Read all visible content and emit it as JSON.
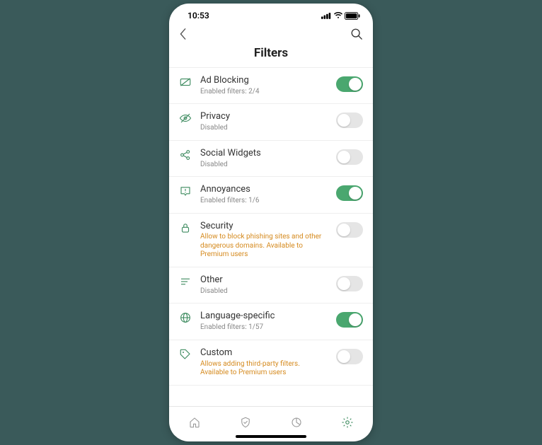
{
  "status": {
    "time": "10:53"
  },
  "header": {
    "title": "Filters"
  },
  "colors": {
    "accent": "#4aa76f",
    "iconGreen": "#3d8b5f",
    "premium": "#d58a1e"
  },
  "filters": [
    {
      "id": "ad-blocking",
      "label": "Ad Blocking",
      "sub": "Enabled filters: 2/4",
      "premium": false,
      "on": true,
      "icon": "ad-block-icon"
    },
    {
      "id": "privacy",
      "label": "Privacy",
      "sub": "Disabled",
      "premium": false,
      "on": false,
      "icon": "eye-off-icon"
    },
    {
      "id": "social",
      "label": "Social Widgets",
      "sub": "Disabled",
      "premium": false,
      "on": false,
      "icon": "share-icon"
    },
    {
      "id": "annoyances",
      "label": "Annoyances",
      "sub": "Enabled filters: 1/6",
      "premium": false,
      "on": true,
      "icon": "alert-box-icon"
    },
    {
      "id": "security",
      "label": "Security",
      "sub": "Allow to block phishing sites and other dangerous domains. Available to Premium users",
      "premium": true,
      "on": false,
      "icon": "lock-icon"
    },
    {
      "id": "other",
      "label": "Other",
      "sub": "Disabled",
      "premium": false,
      "on": false,
      "icon": "lines-icon"
    },
    {
      "id": "language",
      "label": "Language-specific",
      "sub": "Enabled filters: 1/57",
      "premium": false,
      "on": true,
      "icon": "globe-icon"
    },
    {
      "id": "custom",
      "label": "Custom",
      "sub": "Allows adding third-party filters. Available to Premium users",
      "premium": true,
      "on": false,
      "icon": "tag-icon"
    }
  ],
  "tabs": [
    {
      "id": "home",
      "icon": "home-icon",
      "active": false
    },
    {
      "id": "shield",
      "icon": "shield-icon",
      "active": false
    },
    {
      "id": "stats",
      "icon": "pie-icon",
      "active": false
    },
    {
      "id": "settings",
      "icon": "gear-icon",
      "active": true
    }
  ]
}
